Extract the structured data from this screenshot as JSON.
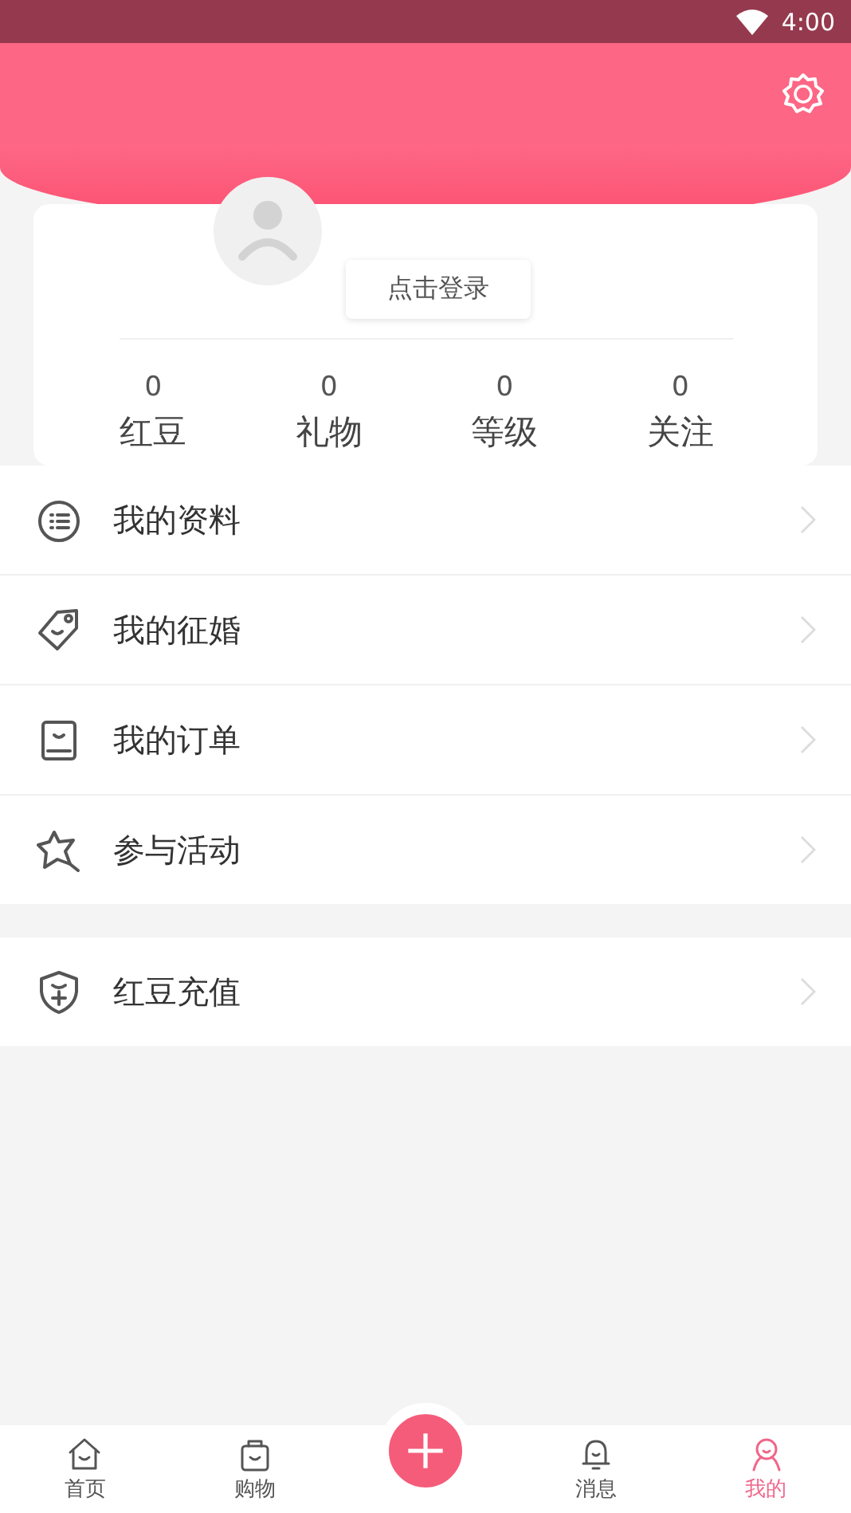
{
  "status_bar": {
    "time": "4:00"
  },
  "profile": {
    "login_button": "点击登录",
    "stats": [
      {
        "value": "0",
        "label": "红豆"
      },
      {
        "value": "0",
        "label": "礼物"
      },
      {
        "value": "0",
        "label": "等级"
      },
      {
        "value": "0",
        "label": "关注"
      }
    ]
  },
  "menu_groups": [
    [
      {
        "label": "我的资料"
      },
      {
        "label": "我的征婚"
      },
      {
        "label": "我的订单"
      },
      {
        "label": "参与活动"
      }
    ],
    [
      {
        "label": "红豆充值"
      }
    ]
  ],
  "tab_bar": [
    {
      "label": "首页",
      "selected": false
    },
    {
      "label": "购物",
      "selected": false
    },
    {
      "kind": "add"
    },
    {
      "label": "消息",
      "selected": false
    },
    {
      "label": "我的",
      "selected": true
    }
  ]
}
